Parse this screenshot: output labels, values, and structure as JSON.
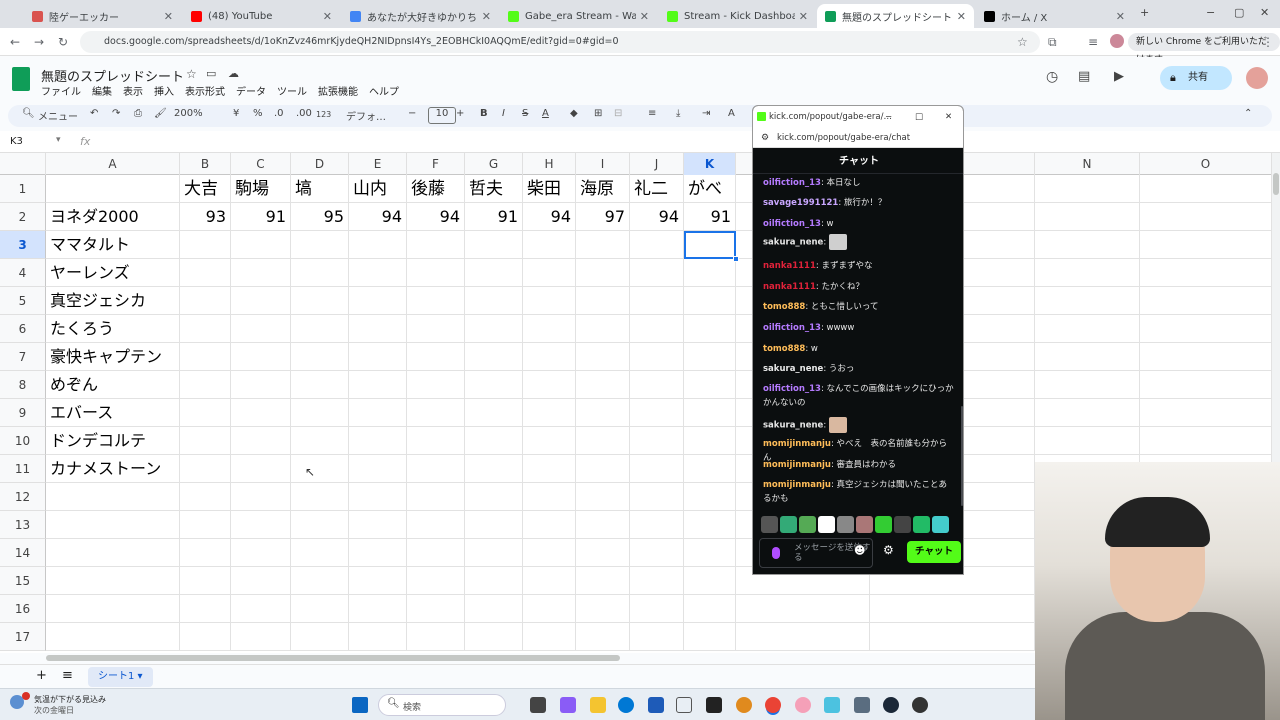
{
  "browser": {
    "tabs": [
      {
        "title": "陸ゲーエッカー",
        "active": false,
        "color": "#d9534f"
      },
      {
        "title": "(48) YouTube",
        "active": false,
        "color": "#ff0000"
      },
      {
        "title": "あなたが大好きゆかりちゃん一ばん…",
        "active": false,
        "color": "#4285f4"
      },
      {
        "title": "Gabe_era Stream - Watch Live",
        "active": false,
        "color": "#53fc18"
      },
      {
        "title": "Stream - Kick Dashboard",
        "active": false,
        "color": "#53fc18"
      },
      {
        "title": "無題のスプレッドシート - Google ス",
        "active": true,
        "color": "#0f9d58"
      },
      {
        "title": "ホーム / X",
        "active": false,
        "color": "#000000"
      }
    ],
    "url": "docs.google.com/spreadsheets/d/1oKnZvz46mrKjydeQH2NIDpnsI4Ys_2EOBHCkI0AQQmE/edit?gid=0#gid=0",
    "update_label": "新しい Chrome をご利用いただけます"
  },
  "sheets": {
    "doc_title": "無題のスプレッドシート",
    "menu": [
      "ファイル",
      "編集",
      "表示",
      "挿入",
      "表示形式",
      "データ",
      "ツール",
      "拡張機能",
      "ヘルプ"
    ],
    "share_label": "共有",
    "toolbar": {
      "search": "メニュー",
      "zoom": "200%",
      "currency": "¥",
      "percent": "%",
      "dec_dec": ".0",
      "inc_dec": ".00",
      "format_123": "123",
      "font": "デフォ…",
      "font_size": "10",
      "bold": "B",
      "italic": "I",
      "strike": "S",
      "underline": "A"
    },
    "cell_ref": "K3",
    "fx": "fx",
    "columns": [
      "A",
      "B",
      "C",
      "D",
      "E",
      "F",
      "G",
      "H",
      "I",
      "J",
      "K",
      "",
      "",
      "N",
      "O"
    ],
    "row_numbers": [
      "1",
      "2",
      "3",
      "4",
      "5",
      "6",
      "7",
      "8",
      "9",
      "10",
      "11",
      "12",
      "13",
      "14",
      "15",
      "16",
      "17"
    ],
    "header_row": [
      "",
      "大吉",
      "駒場",
      "塙",
      "山内",
      "後藤",
      "哲夫",
      "柴田",
      "海原",
      "礼二",
      "がべ"
    ],
    "score_row": [
      "ヨネダ2000",
      "93",
      "91",
      "95",
      "94",
      "94",
      "91",
      "94",
      "97",
      "94",
      "91"
    ],
    "names": [
      "ママタルト",
      "ヤーレンズ",
      "真空ジェシカ",
      "たくろう",
      "豪快キャプテン",
      "めぞん",
      "エバース",
      "ドンデコルテ",
      "カナメストーン"
    ],
    "sheet_tab": "シート1",
    "add_sheet": "+",
    "all_sheets": "≡"
  },
  "taskbar": {
    "weather_line1": "気温が下がる見込み",
    "weather_line2": "次の金曜日",
    "search_placeholder": "検索"
  },
  "chat": {
    "window_title": "kick.com/popout/gabe-era/…",
    "url": "kick.com/popout/gabe-era/chat",
    "header": "チャット",
    "messages": [
      {
        "user": "oilfiction_13",
        "text": "本日なし",
        "color": "#b57bff"
      },
      {
        "user": "savage1991121",
        "text": "旅行か！？",
        "color": "#c9a7ff"
      },
      {
        "user": "oilfiction_13",
        "text": "w",
        "color": "#b57bff"
      },
      {
        "user": "sakura_nene",
        "text": "",
        "color": "#e8e8e8",
        "emote": "#cfcfcf"
      },
      {
        "user": "nanka1111",
        "text": "まずまずやな",
        "color": "#e0223a"
      },
      {
        "user": "nanka1111",
        "text": "たかくね？",
        "color": "#e0223a"
      },
      {
        "user": "tomo888",
        "text": "ともこ惜しいって",
        "color": "#ffbd59"
      },
      {
        "user": "oilfiction_13",
        "text": "wwww",
        "color": "#b57bff"
      },
      {
        "user": "tomo888",
        "text": "w",
        "color": "#ffbd59"
      },
      {
        "user": "sakura_nene",
        "text": "うおっ",
        "color": "#e8e8e8"
      },
      {
        "user": "oilfiction_13",
        "text": "なんでこの画像はキックにひっかかんないの",
        "color": "#b57bff"
      },
      {
        "user": "sakura_nene",
        "text": "",
        "color": "#e8e8e8",
        "emote": "#d9b8a0"
      },
      {
        "user": "momijinmanju",
        "text": "やべえ　表の名前誰も分からん",
        "color": "#ffbd59"
      },
      {
        "user": "momijinmanju",
        "text": "審査員はわかる",
        "color": "#ffbd59"
      },
      {
        "user": "momijinmanju",
        "text": "真空ジェシカは聞いたことあるかも",
        "color": "#ffbd59"
      }
    ],
    "input_placeholder": "メッセージを送信する",
    "send_label": "チャット"
  }
}
